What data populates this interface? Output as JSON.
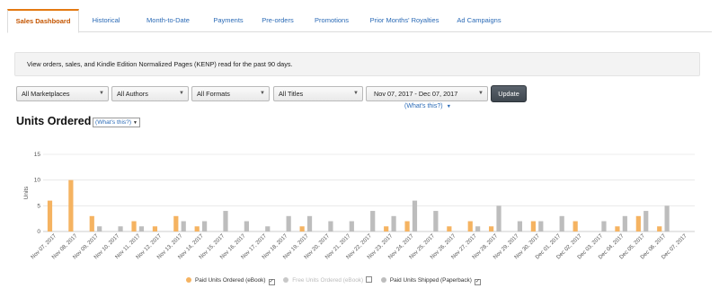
{
  "tabs": [
    {
      "label": "Sales Dashboard",
      "active": true
    },
    {
      "label": "Historical",
      "active": false
    },
    {
      "label": "Month-to-Date",
      "active": false
    },
    {
      "label": "Payments",
      "active": false
    },
    {
      "label": "Pre-orders",
      "active": false
    },
    {
      "label": "Promotions",
      "active": false
    },
    {
      "label": "Prior Months' Royalties",
      "active": false
    },
    {
      "label": "Ad Campaigns",
      "active": false
    }
  ],
  "info_text": "View orders, sales, and Kindle Edition Normalized Pages (KENP) read for the past 90 days.",
  "filters": {
    "marketplace": "All Marketplaces",
    "authors": "All Authors",
    "formats": "All Formats",
    "titles": "All Titles",
    "date_range": "Nov 07, 2017 - Dec 07, 2017"
  },
  "update_label": "Update",
  "whats_this_link": "(What's this?)",
  "section_title": "Units Ordered",
  "whats_this_box": "(What's this?)",
  "colors": {
    "paid": "#f5b361",
    "free": "#c8c8c8",
    "shipped": "#bdbdbd",
    "accent": "#e47911",
    "link": "#2a6ab6"
  },
  "chart_data": {
    "type": "bar",
    "title": "Units Ordered",
    "xlabel": "",
    "ylabel": "Units",
    "ylim": [
      0,
      15
    ],
    "yticks": [
      0,
      5,
      10,
      15
    ],
    "grid": true,
    "legend_position": "bottom",
    "categories": [
      "Nov 07, 2017",
      "Nov 08, 2017",
      "Nov 09, 2017",
      "Nov 10, 2017",
      "Nov 11, 2017",
      "Nov 12, 2017",
      "Nov 13, 2017",
      "Nov 14, 2017",
      "Nov 15, 2017",
      "Nov 16, 2017",
      "Nov 17, 2017",
      "Nov 18, 2017",
      "Nov 19, 2017",
      "Nov 20, 2017",
      "Nov 21, 2017",
      "Nov 22, 2017",
      "Nov 23, 2017",
      "Nov 24, 2017",
      "Nov 25, 2017",
      "Nov 26, 2017",
      "Nov 27, 2017",
      "Nov 28, 2017",
      "Nov 29, 2017",
      "Nov 30, 2017",
      "Dec 01, 2017",
      "Dec 02, 2017",
      "Dec 03, 2017",
      "Dec 04, 2017",
      "Dec 05, 2017",
      "Dec 06, 2017",
      "Dec 07, 2017"
    ],
    "series": [
      {
        "name": "Paid Units Ordered (eBook)",
        "values": [
          6,
          10,
          3,
          0,
          2,
          1,
          3,
          1,
          0,
          0,
          0,
          0,
          1,
          0,
          0,
          0,
          1,
          2,
          0,
          1,
          2,
          1,
          0,
          2,
          0,
          2,
          0,
          1,
          3,
          1,
          0
        ]
      },
      {
        "name": "Free Units Ordered (eBook)",
        "values": [
          0,
          0,
          0,
          0,
          0,
          0,
          0,
          0,
          0,
          0,
          0,
          0,
          0,
          0,
          0,
          0,
          0,
          0,
          0,
          0,
          0,
          0,
          0,
          0,
          0,
          0,
          0,
          0,
          0,
          0,
          0
        ]
      },
      {
        "name": "Paid Units Shipped (Paperback)",
        "values": [
          0,
          0,
          1,
          1,
          1,
          0,
          2,
          2,
          4,
          2,
          1,
          3,
          3,
          2,
          2,
          4,
          3,
          6,
          4,
          0,
          1,
          5,
          2,
          2,
          3,
          0,
          2,
          3,
          4,
          5,
          0
        ]
      }
    ]
  },
  "legend": [
    {
      "label": "Paid Units Ordered (eBook)",
      "checked": true
    },
    {
      "label": "Free Units Ordered (eBook)",
      "checked": false
    },
    {
      "label": "Paid Units Shipped (Paperback)",
      "checked": true
    }
  ]
}
